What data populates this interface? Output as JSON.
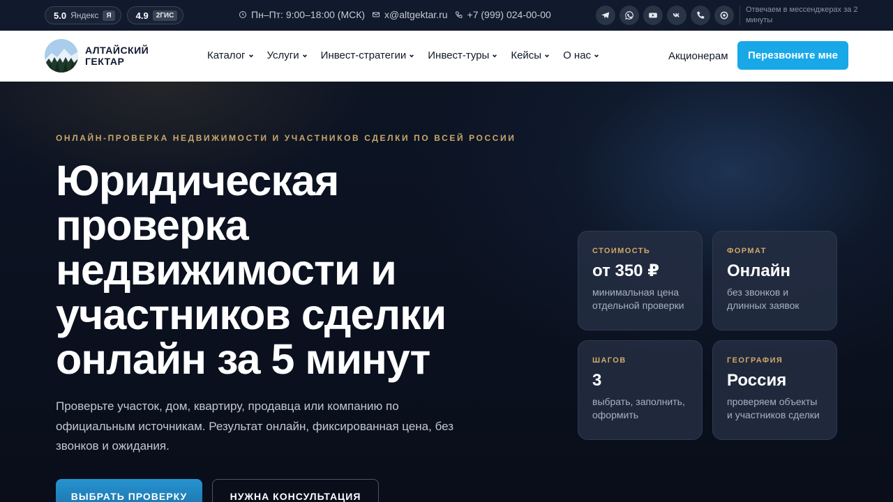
{
  "topbar": {
    "ratings": [
      {
        "score": "5.0",
        "label": "Яндекс",
        "badge": "Я"
      },
      {
        "score": "4.9",
        "label": "",
        "badge": "2ГИС"
      }
    ],
    "hours": "Пн–Пт: 9:00–18:00 (МСК)",
    "email": "x@altgektar.ru",
    "phone": "+7 (999) 024-00-00",
    "socials": [
      "telegram-icon",
      "whatsapp-icon",
      "youtube-icon",
      "vk-icon",
      "phone-icon",
      "max-icon"
    ],
    "reply_note": "Отвечаем в мессенджерах за 2 минуты"
  },
  "nav": {
    "logo_line1": "АЛТАЙСКИЙ",
    "logo_line2": "ГЕКТАР",
    "menu": [
      {
        "label": "Каталог"
      },
      {
        "label": "Услуги"
      },
      {
        "label": "Инвест-стратегии"
      },
      {
        "label": "Инвест-туры"
      },
      {
        "label": "Кейсы"
      },
      {
        "label": "О нас"
      }
    ],
    "shareholders": "Акционерам",
    "callback": "Перезвоните мне"
  },
  "hero": {
    "eyebrow": "ОНЛАЙН-ПРОВЕРКА НЕДВИЖИМОСТИ И УЧАСТНИКОВ СДЕЛКИ ПО ВСЕЙ РОССИИ",
    "headline": "Юридическая проверка недвижимости и участников сделки онлайн за 5 минут",
    "lead": "Проверьте участок, дом, квартиру, продавца или компанию по официальным источникам. Результат онлайн, фиксированная цена, без звонков и ожидания.",
    "btn_primary": "ВЫБРАТЬ ПРОВЕРКУ",
    "btn_secondary": "НУЖНА КОНСУЛЬТАЦИЯ",
    "stats": [
      {
        "label": "СТОИМОСТЬ",
        "value": "от 350 ₽",
        "desc": "минимальная цена отдельной проверки"
      },
      {
        "label": "ФОРМАТ",
        "value": "Онлайн",
        "desc": "без звонков и длинных заявок"
      },
      {
        "label": "ШАГОВ",
        "value": "3",
        "desc": "выбрать, заполнить, оформить"
      },
      {
        "label": "ГЕОГРАФИЯ",
        "value": "Россия",
        "desc": "проверяем объекты и участников сделки"
      }
    ]
  },
  "colors": {
    "accent": "#18a8e8",
    "gold": "#c9a86a",
    "background": "#0b1120"
  }
}
